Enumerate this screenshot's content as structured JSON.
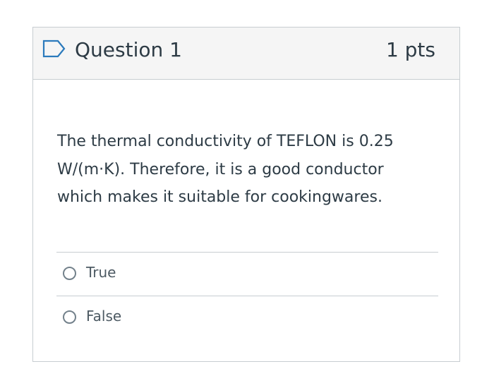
{
  "question": {
    "title": "Question 1",
    "points": "1 pts",
    "flag_icon": "flag-outline-icon",
    "text_lines": [
      "The thermal conductivity of TEFLON is  0.25",
      "W/(m·K). Therefore, it is a good conductor",
      "which makes it suitable for cookingwares."
    ]
  },
  "answers": [
    {
      "label": "True",
      "selected": false
    },
    {
      "label": "False",
      "selected": false
    }
  ],
  "colors": {
    "header_background": "#f5f5f5",
    "border": "#c7cdd1",
    "text": "#2d3b45",
    "flag": "#2b7abc",
    "radio_border": "#73818b"
  }
}
